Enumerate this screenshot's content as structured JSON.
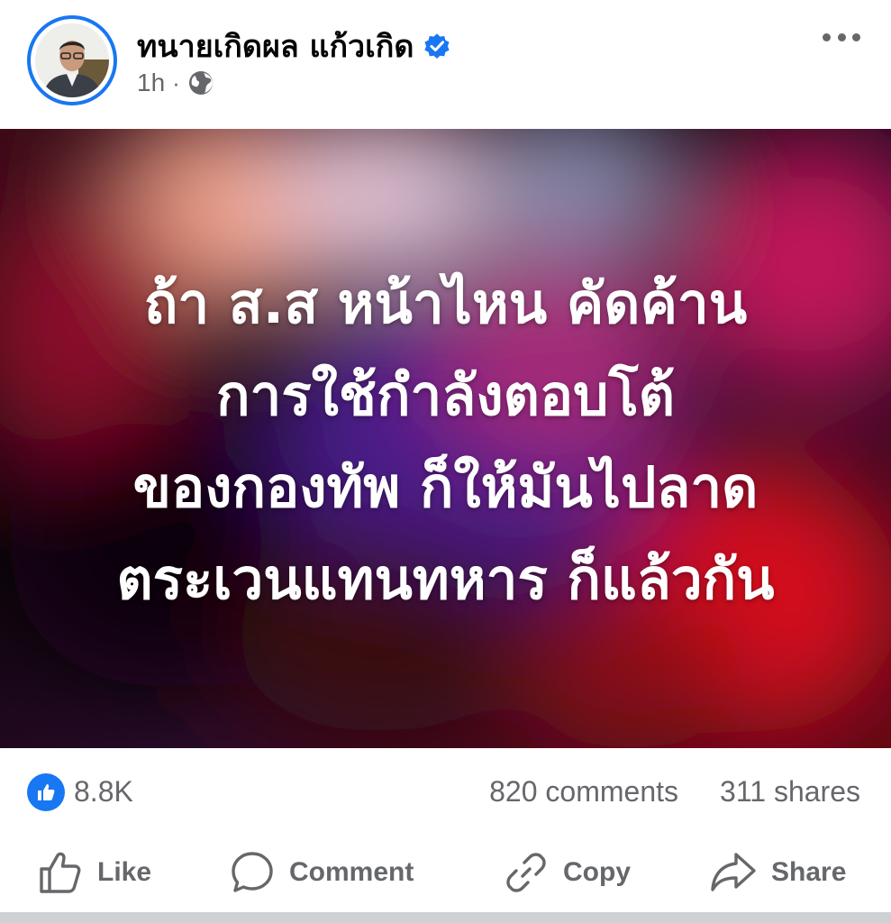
{
  "post": {
    "author": {
      "name": "ทนายเกิดผล แก้วเกิด",
      "verified": true
    },
    "time": "1h",
    "separator": "·",
    "privacy_icon": "globe-icon",
    "text_lines": [
      "ถ้า ส.ส หน้าไหน คัดค้าน",
      "การใช้กำลังตอบโต้",
      "ของกองทัพ ก็ให้มันไปลาด",
      "ตระเวนแทนทหาร ก็แล้วกัน"
    ]
  },
  "stats": {
    "reactions": "8.8K",
    "comments": "820 comments",
    "shares": "311 shares"
  },
  "actions": {
    "like": "Like",
    "comment": "Comment",
    "copy": "Copy",
    "share": "Share"
  },
  "colors": {
    "accent": "#1877f2",
    "secondary_text": "#65676b"
  }
}
